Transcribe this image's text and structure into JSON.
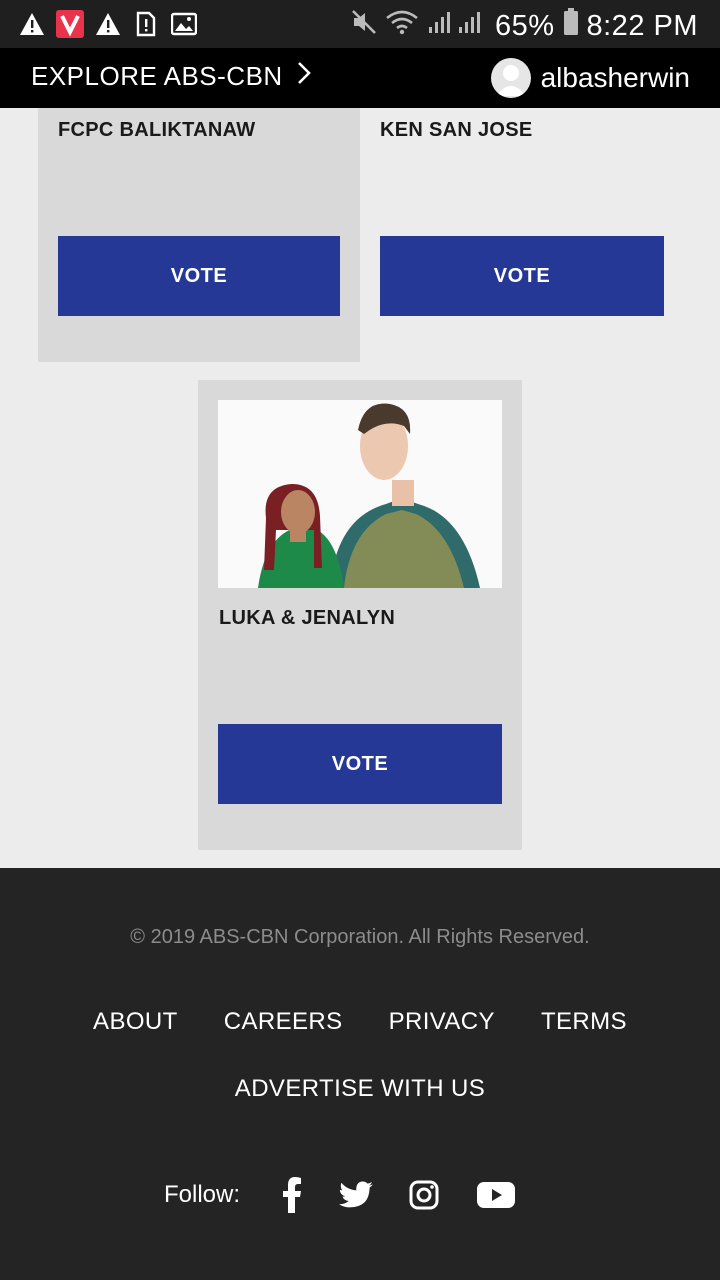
{
  "status_bar": {
    "battery": "65%",
    "time": "8:22 PM"
  },
  "nav": {
    "explore_label": "EXPLORE ABS-CBN",
    "username": "albasherwin"
  },
  "cards": [
    {
      "name": "FCPC BALIKTANAW",
      "vote_label": "VOTE"
    },
    {
      "name": "KEN SAN JOSE",
      "vote_label": "VOTE"
    },
    {
      "name": "LUKA & JENALYN",
      "vote_label": "VOTE"
    }
  ],
  "footer": {
    "copyright": "© 2019 ABS-CBN Corporation. All Rights Reserved.",
    "links": [
      "ABOUT",
      "CAREERS",
      "PRIVACY",
      "TERMS"
    ],
    "advertise": "ADVERTISE WITH US",
    "follow_label": "Follow:"
  },
  "colors": {
    "vote_button": "#263896",
    "card_bg": "#d9d9d9",
    "page_bg": "#ececec",
    "footer_bg": "#242424",
    "nav_bg": "#000000"
  },
  "icons": [
    "warning-icon",
    "vivavideo-app-icon",
    "sim-alert-icon",
    "image-icon",
    "mute-icon",
    "wifi-icon",
    "signal-icon",
    "battery-icon",
    "chevron-right-icon",
    "user-avatar-icon",
    "facebook-icon",
    "twitter-icon",
    "instagram-icon",
    "youtube-icon"
  ]
}
